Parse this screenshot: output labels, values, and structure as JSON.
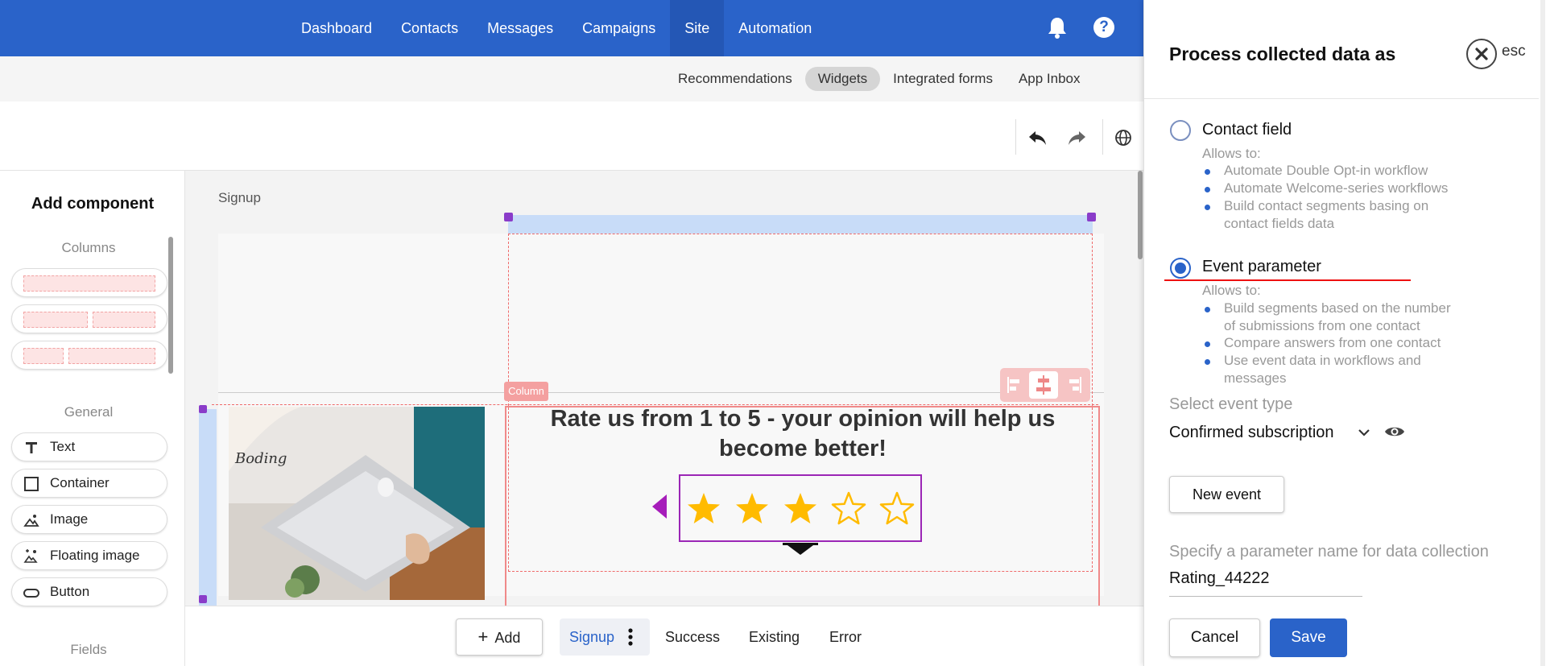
{
  "nav": {
    "items": [
      "Dashboard",
      "Contacts",
      "Messages",
      "Campaigns",
      "Site",
      "Automation"
    ],
    "active": "Site",
    "bell_icon": "bell-icon",
    "help_icon": "help-icon"
  },
  "subnav": {
    "items": [
      "Recommendations",
      "Widgets",
      "Integrated forms",
      "App Inbox"
    ],
    "active": "Widgets"
  },
  "toolbar": {
    "icons": [
      "undo-icon",
      "redo-icon",
      "globe-icon"
    ]
  },
  "left_panel": {
    "title": "Add component",
    "columns_title": "Columns",
    "general_title": "General",
    "components": [
      {
        "label": "Text",
        "icon": "text-icon"
      },
      {
        "label": "Container",
        "icon": "container-icon"
      },
      {
        "label": "Image",
        "icon": "image-icon"
      },
      {
        "label": "Floating image",
        "icon": "floating-image-icon"
      },
      {
        "label": "Button",
        "icon": "button-icon"
      }
    ],
    "fields_title": "Fields"
  },
  "canvas": {
    "title": "Signup",
    "column_tag": "Column",
    "headline": "Rate us from 1 to 5 - your opinion will help us become better!",
    "rating": {
      "filled": 3,
      "total": 5
    },
    "accent": "#c026d3"
  },
  "bottom_tabs": {
    "add_label": "Add",
    "tabs": [
      "Signup",
      "Success",
      "Existing",
      "Error"
    ],
    "active": "Signup"
  },
  "panel": {
    "title": "Process collected data as",
    "esc_label": "esc",
    "option1": {
      "label": "Contact field",
      "allows": "Allows to:",
      "bullets": [
        "Automate Double Opt-in workflow",
        "Automate Welcome-series workflows",
        "Build contact segments basing on contact fields data"
      ]
    },
    "option2": {
      "label": "Event parameter",
      "allows": "Allows to:",
      "bullets": [
        "Build segments based on the number of submissions from one contact",
        "Compare answers from one contact",
        "Use event data in workflows and messages"
      ]
    },
    "selected": "Event parameter",
    "event_type_label": "Select event type",
    "event_type_value": "Confirmed subscription",
    "new_event_label": "New event",
    "param_label": "Specify a parameter name for data collection",
    "param_value": "Rating_44222",
    "cancel_label": "Cancel",
    "save_label": "Save"
  },
  "colors": {
    "primary": "#2a63c9",
    "star": "#ffbb00",
    "highlight_line": "#e11111"
  }
}
